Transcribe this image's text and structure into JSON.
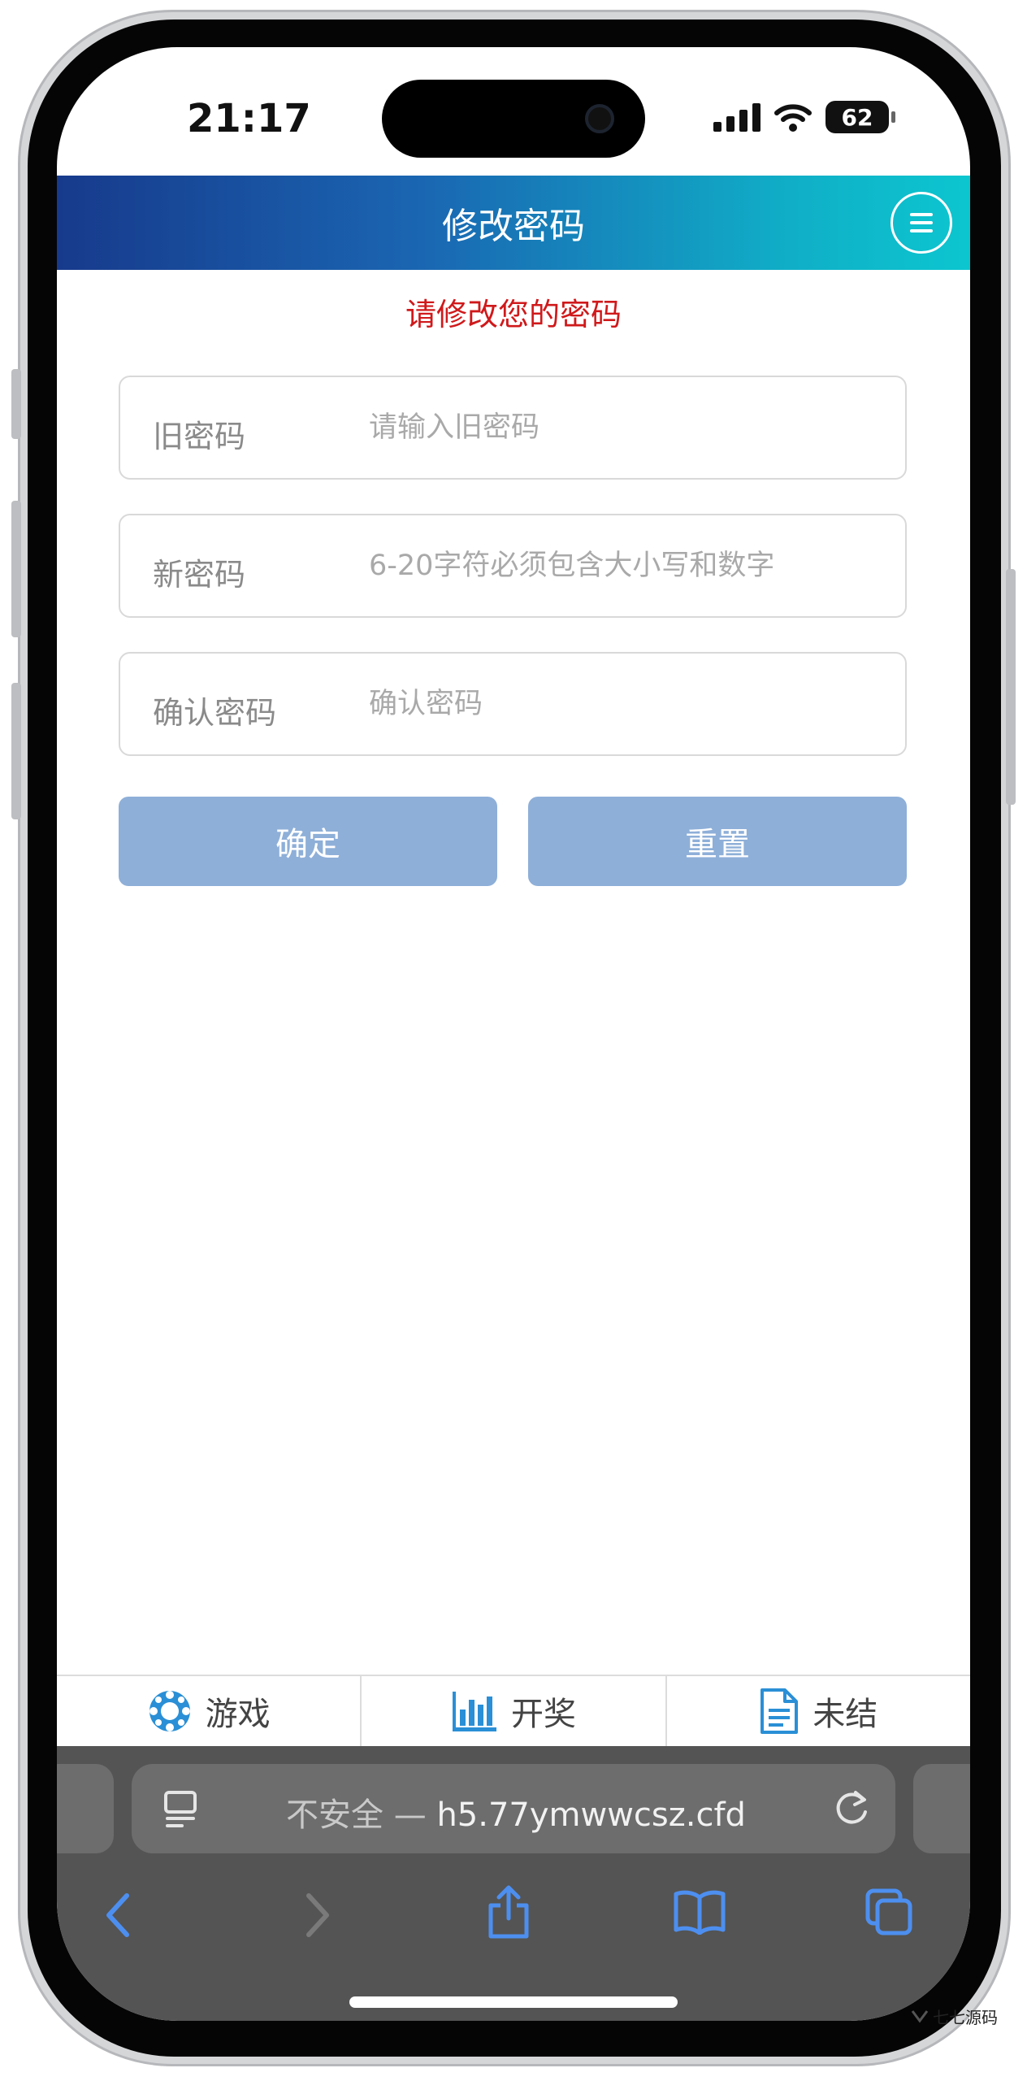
{
  "status_bar": {
    "time": "21:17",
    "battery": "62"
  },
  "header": {
    "title": "修改密码"
  },
  "notice": "请修改您的密码",
  "form": {
    "old_password": {
      "label": "旧密码",
      "placeholder": "请输入旧密码"
    },
    "new_password": {
      "label": "新密码",
      "placeholder": "6-20字符必须包含大小写和数字"
    },
    "confirm_password": {
      "label": "确认密码",
      "placeholder": "确认密码"
    }
  },
  "buttons": {
    "confirm": "确定",
    "reset": "重置"
  },
  "tabbar": {
    "games": "游戏",
    "lottery": "开奖",
    "unsettled": "未结"
  },
  "browser": {
    "insecure": "不安全 —",
    "domain": "h5.77ymwwcsz.cfd"
  },
  "watermark": "七七源码",
  "colors": {
    "header_start": "#173a8c",
    "header_end": "#0cc6cf",
    "notice": "#d0191b",
    "button": "#8eafd8",
    "tab_icon": "#2a8fd6",
    "safari_icon": "#4d8ff0"
  }
}
